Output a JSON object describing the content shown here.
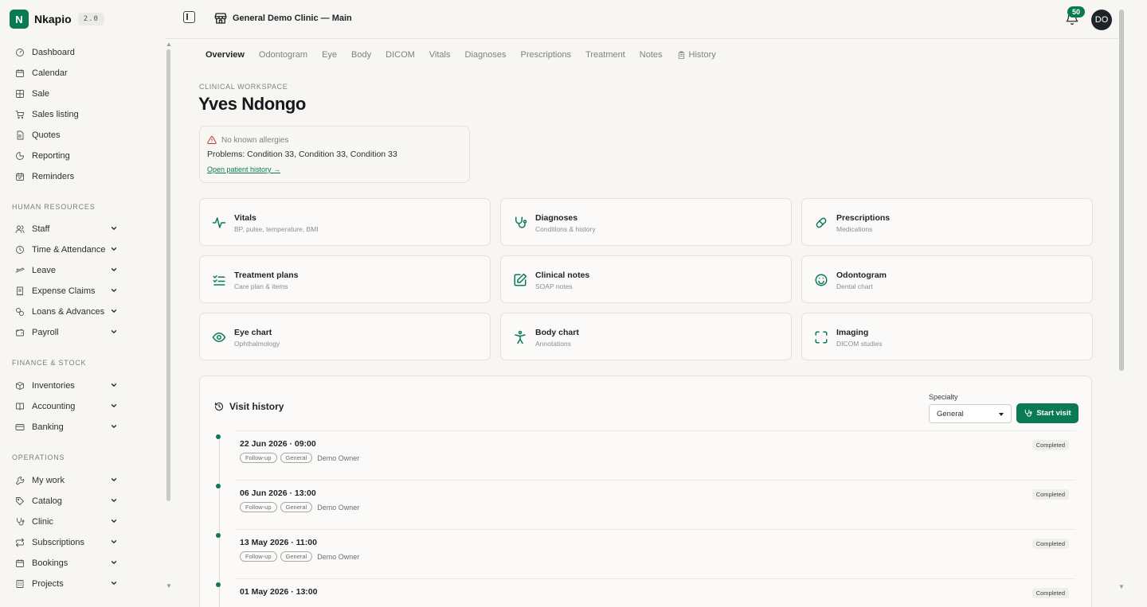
{
  "brand": {
    "name": "Nkapio",
    "logo_letter": "N",
    "version": "2.0"
  },
  "sidebar": {
    "items_top": [
      {
        "label": "Dashboard",
        "icon": "gauge-icon"
      },
      {
        "label": "Calendar",
        "icon": "calendar-icon"
      },
      {
        "label": "Sale",
        "icon": "grid-icon"
      },
      {
        "label": "Sales listing",
        "icon": "cart-icon"
      },
      {
        "label": "Quotes",
        "icon": "document-icon"
      },
      {
        "label": "Reporting",
        "icon": "pie-chart-icon"
      },
      {
        "label": "Reminders",
        "icon": "calendar-check-icon"
      }
    ],
    "section_hr": "HUMAN RESOURCES",
    "items_hr": [
      {
        "label": "Staff",
        "icon": "users-icon"
      },
      {
        "label": "Time & Attendance",
        "icon": "clock-icon"
      },
      {
        "label": "Leave",
        "icon": "plane-icon"
      },
      {
        "label": "Expense Claims",
        "icon": "receipt-icon"
      },
      {
        "label": "Loans & Advances",
        "icon": "coins-icon"
      },
      {
        "label": "Payroll",
        "icon": "wallet-icon"
      }
    ],
    "section_finance": "FINANCE & STOCK",
    "items_finance": [
      {
        "label": "Inventories",
        "icon": "box-icon"
      },
      {
        "label": "Accounting",
        "icon": "book-icon"
      },
      {
        "label": "Banking",
        "icon": "card-icon"
      }
    ],
    "section_ops": "OPERATIONS",
    "items_ops": [
      {
        "label": "My work",
        "icon": "wrench-icon"
      },
      {
        "label": "Catalog",
        "icon": "tag-icon"
      },
      {
        "label": "Clinic",
        "icon": "stethoscope-icon"
      },
      {
        "label": "Subscriptions",
        "icon": "repeat-icon"
      },
      {
        "label": "Bookings",
        "icon": "calendar-icon"
      },
      {
        "label": "Projects",
        "icon": "building-icon"
      }
    ]
  },
  "topbar": {
    "store_name": "General Demo Clinic — Main",
    "notifications": "50",
    "avatar_initials": "DO"
  },
  "tabs": [
    "Overview",
    "Odontogram",
    "Eye",
    "Body",
    "DICOM",
    "Vitals",
    "Diagnoses",
    "Prescriptions",
    "Treatment",
    "Notes",
    "History"
  ],
  "patient": {
    "eyebrow": "CLINICAL WORKSPACE",
    "name": "Yves Ndongo",
    "allergies": "No known allergies",
    "problems": "Problems: Condition 33, Condition 33, Condition 33",
    "history_link": "Open patient history →"
  },
  "cards": [
    {
      "title": "Vitals",
      "subtitle": "BP, pulse, temperature, BMI",
      "icon": "pulse-icon"
    },
    {
      "title": "Diagnoses",
      "subtitle": "Conditions & history",
      "icon": "stethoscope-icon"
    },
    {
      "title": "Prescriptions",
      "subtitle": "Medications",
      "icon": "pill-icon"
    },
    {
      "title": "Treatment plans",
      "subtitle": "Care plan & items",
      "icon": "checklist-icon"
    },
    {
      "title": "Clinical notes",
      "subtitle": "SOAP notes",
      "icon": "note-edit-icon"
    },
    {
      "title": "Odontogram",
      "subtitle": "Dental chart",
      "icon": "smile-icon"
    },
    {
      "title": "Eye chart",
      "subtitle": "Ophthalmology",
      "icon": "eye-icon"
    },
    {
      "title": "Body chart",
      "subtitle": "Annotations",
      "icon": "person-icon"
    },
    {
      "title": "Imaging",
      "subtitle": "DICOM studies",
      "icon": "scan-icon"
    }
  ],
  "visit_history": {
    "title": "Visit history",
    "specialty_label": "Specialty",
    "specialty_value": "General",
    "start_button": "Start visit",
    "visits": [
      {
        "date": "22 Jun 2026 · 09:00",
        "type": "Follow-up",
        "specialty": "General",
        "owner": "Demo Owner",
        "status": "Completed"
      },
      {
        "date": "06 Jun 2026 · 13:00",
        "type": "Follow-up",
        "specialty": "General",
        "owner": "Demo Owner",
        "status": "Completed"
      },
      {
        "date": "13 May 2026 · 11:00",
        "type": "Follow-up",
        "specialty": "General",
        "owner": "Demo Owner",
        "status": "Completed"
      },
      {
        "date": "01 May 2026 · 13:00",
        "type": "",
        "specialty": "",
        "owner": "",
        "status": "Completed"
      }
    ]
  },
  "colors": {
    "accent": "#0a7a55",
    "background": "#f7f6f3",
    "alert": "#c0392b"
  }
}
